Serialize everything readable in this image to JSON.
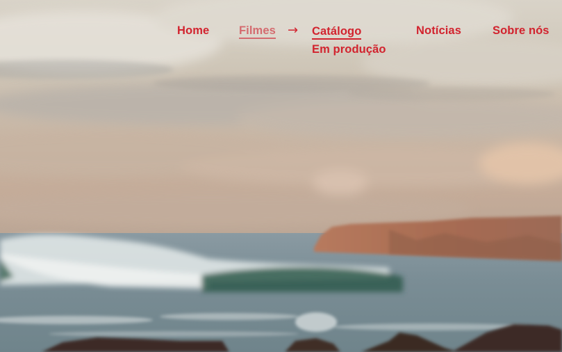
{
  "nav": {
    "home": "Home",
    "filmes": "Filmes",
    "arrow": "→",
    "catalogo": "Catálogo",
    "em_producao": "Em produção",
    "noticias": "Notícias",
    "sobre_nos": "Sobre nós"
  },
  "colors": {
    "accent": "#d2232e",
    "accent_muted": "#d46b6f"
  }
}
